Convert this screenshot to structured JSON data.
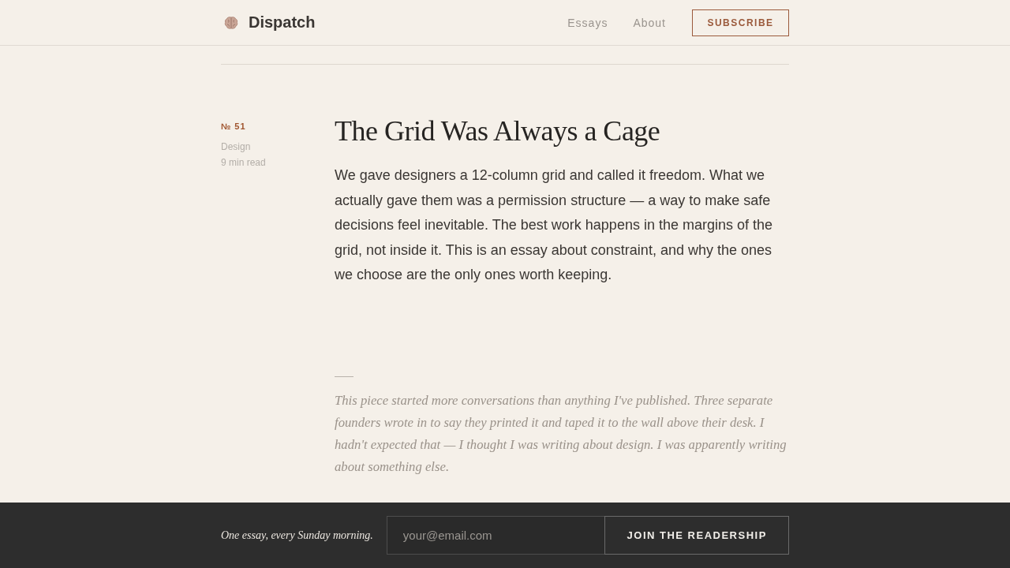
{
  "header": {
    "brand": "Dispatch",
    "nav": [
      {
        "label": "Essays"
      },
      {
        "label": "About"
      }
    ],
    "subscribe_button": "SUBSCRIBE"
  },
  "article": {
    "number": "№ 51",
    "category": "Design",
    "read_time": "9 min read",
    "title": "The Grid Was Always a Cage",
    "lede": "We gave designers a 12-column grid and called it freedom. What we actually gave them was a permission structure — a way to make safe decisions feel inevitable. The best work happens in the margins of the grid, not inside it. This is an essay about constraint, and why the ones we choose are the only ones worth keeping.",
    "afterword": "This piece started more conversations than anything I've published. Three separate founders wrote in to say they printed it and taped it to the wall above their desk. I hadn't expected that — I thought I was writing about design. I was apparently writing about something else."
  },
  "footer": {
    "tagline": "One essay, every Sunday morning.",
    "email_field": {
      "placeholder": "your@email.com"
    },
    "join_button": "JOIN THE READERSHIP"
  }
}
